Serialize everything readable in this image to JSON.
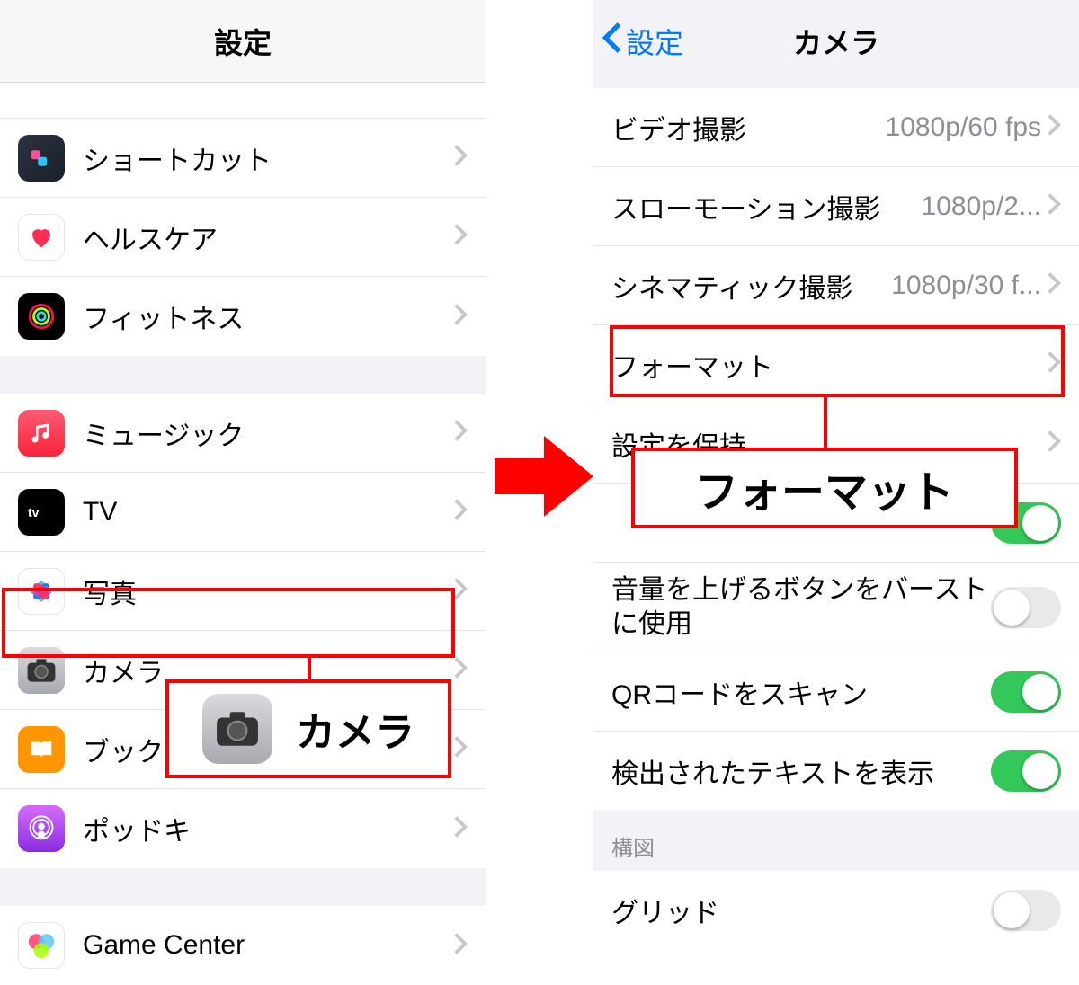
{
  "left": {
    "title": "設定",
    "items_top": [
      {
        "id": "cut",
        "label": ""
      },
      {
        "id": "shortcuts",
        "label": "ショートカット"
      },
      {
        "id": "health",
        "label": "ヘルスケア"
      },
      {
        "id": "fitness",
        "label": "フィットネス"
      }
    ],
    "items_mid": [
      {
        "id": "music",
        "label": "ミュージック"
      },
      {
        "id": "tv",
        "label": "TV"
      },
      {
        "id": "photos",
        "label": "写真"
      },
      {
        "id": "camera",
        "label": "カメラ"
      },
      {
        "id": "books",
        "label": "ブック"
      },
      {
        "id": "podcasts",
        "label": "ポッドキ"
      }
    ],
    "items_bot": [
      {
        "id": "gamecenter",
        "label": "Game Center"
      }
    ],
    "callout_label": "カメラ"
  },
  "right": {
    "back": "設定",
    "title": "カメラ",
    "rows": [
      {
        "kind": "detail",
        "label": "ビデオ撮影",
        "value": "1080p/60 fps"
      },
      {
        "kind": "detail",
        "label": "スローモーション撮影",
        "value": "1080p/2..."
      },
      {
        "kind": "detail",
        "label": "シネマティック撮影",
        "value": "1080p/30 f..."
      },
      {
        "kind": "nav",
        "label": "フォーマット"
      },
      {
        "kind": "nav",
        "label": "設定を保持"
      },
      {
        "kind": "toggle",
        "label": "",
        "on": true
      },
      {
        "kind": "toggle2",
        "label": "音量を上げるボタンをバーストに使用",
        "on": false
      },
      {
        "kind": "toggle",
        "label": "QRコードをスキャン",
        "on": true
      },
      {
        "kind": "toggle",
        "label": "検出されたテキストを表示",
        "on": true
      }
    ],
    "section": "構図",
    "grid": "グリッド",
    "callout_label": "フォーマット"
  }
}
